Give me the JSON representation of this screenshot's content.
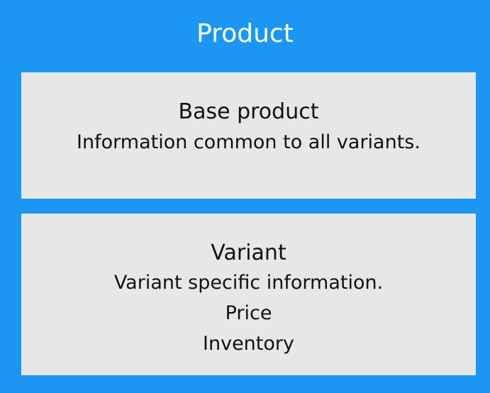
{
  "title": "Product",
  "base": {
    "heading": "Base product",
    "description": "Information common to all variants."
  },
  "variant": {
    "heading": "Variant",
    "lines": [
      "Variant specific information.",
      "Price",
      "Inventory"
    ]
  },
  "colors": {
    "background": "#1b97f3",
    "box": "#e7e7e7",
    "title_text": "#ffffff"
  }
}
